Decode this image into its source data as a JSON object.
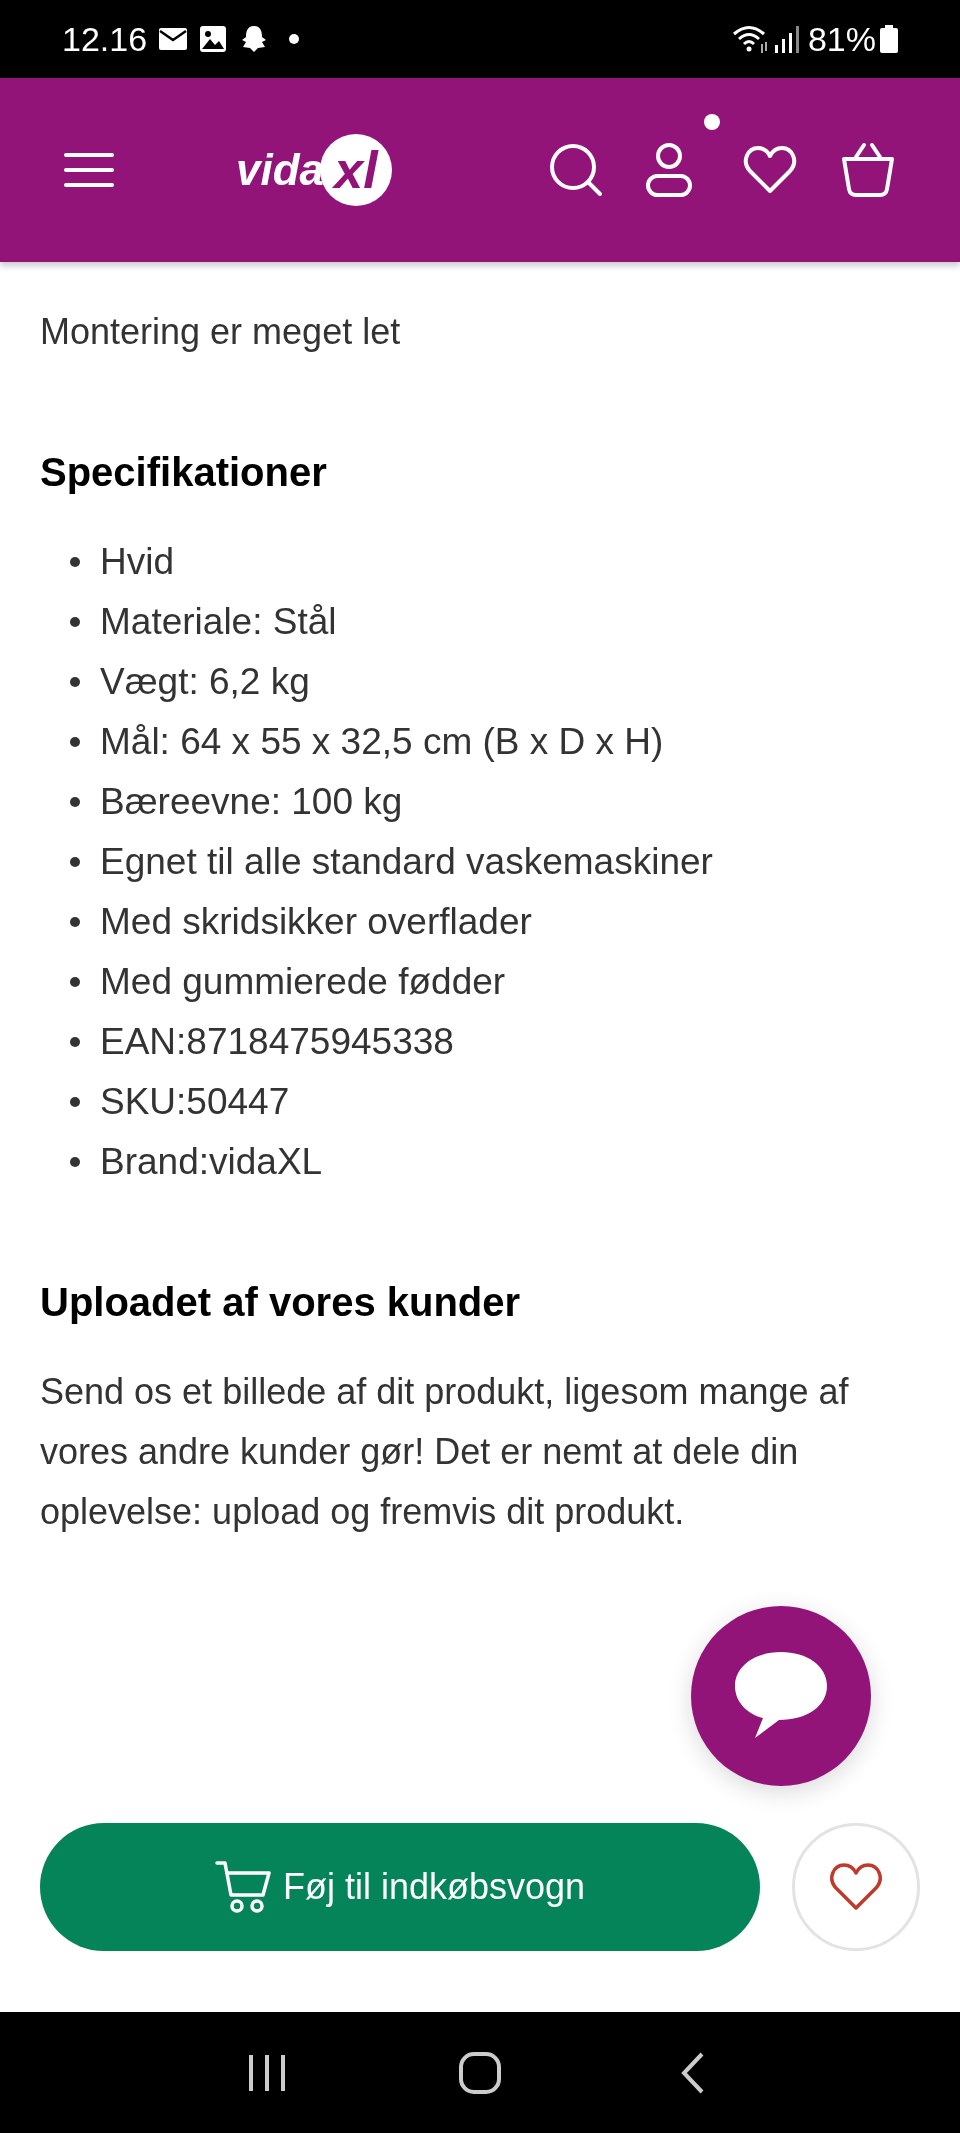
{
  "status_bar": {
    "time": "12.16",
    "battery": "81%"
  },
  "header": {
    "logo": {
      "left": "vida",
      "right": "xl"
    },
    "notification_dot": true
  },
  "intro": "Montering er meget let",
  "specs": {
    "title": "Specifikationer",
    "items": [
      "Hvid",
      "Materiale: Stål",
      "Vægt: 6,2 kg",
      "Mål: 64 x 55 x 32,5 cm (B x D x H)",
      "Bæreevne: 100 kg",
      "Egnet til alle standard vaskemaskiner",
      "Med skridsikker overflader",
      "Med gummierede fødder",
      "EAN:8718475945338",
      "SKU:50447",
      "Brand:vidaXL"
    ]
  },
  "uploads": {
    "title": "Uploadet af vores kunder",
    "text": "Send os et billede af dit produkt, ligesom mange af vores andre kunder gør! Det er nemt at dele din oplevelse: upload og fremvis dit produkt."
  },
  "add_to_cart": {
    "label": "Føj til indkøbsvogn"
  },
  "wishlist": {
    "selected": false
  }
}
